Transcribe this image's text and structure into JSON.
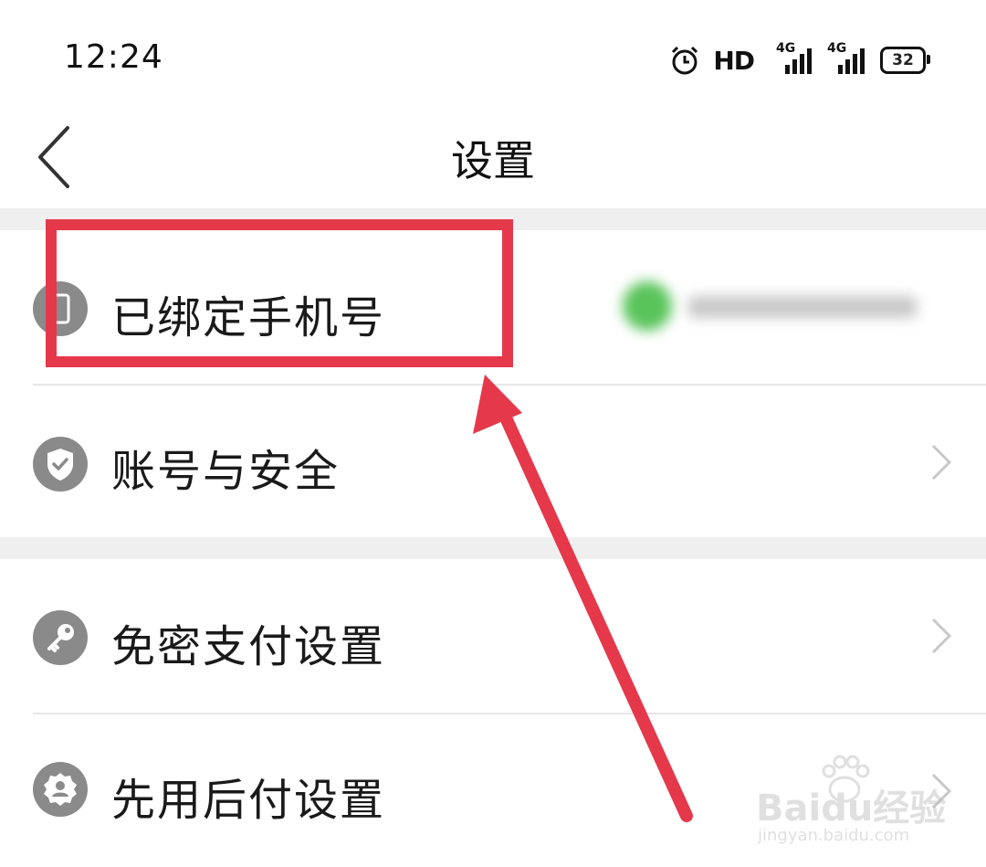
{
  "status_bar": {
    "time": "12:24",
    "hd_label": "HD",
    "signal1_label": "4G",
    "signal2_label": "4G",
    "battery": "32"
  },
  "header": {
    "title": "设置"
  },
  "settings": {
    "items": [
      {
        "label": "已绑定手机号",
        "icon": "phone-icon"
      },
      {
        "label": "账号与安全",
        "icon": "shield-check-icon"
      },
      {
        "label": "免密支付设置",
        "icon": "key-icon"
      },
      {
        "label": "先用后付设置",
        "icon": "badge-user-icon"
      }
    ]
  },
  "watermark": {
    "brand": "Baidu经验",
    "url": "jingyan.baidu.com"
  },
  "colors": {
    "highlight": "#e5384b",
    "icon_gray": "#8a8a8a",
    "section_gap": "#efefef",
    "chevron": "#c8c8c8"
  }
}
